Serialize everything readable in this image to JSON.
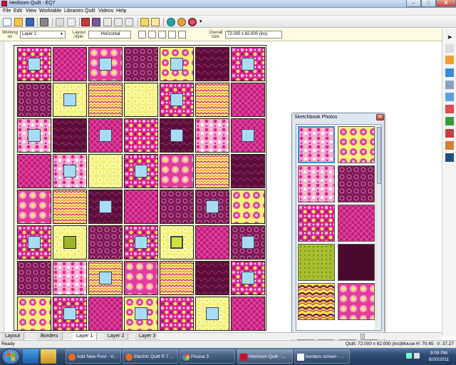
{
  "window": {
    "title": "Heirloom Quilt - EQ7",
    "min_label": "–",
    "max_label": "□",
    "close_label": "X"
  },
  "menu": [
    "File",
    "Edit",
    "View",
    "Worktable",
    "Libraries",
    "Quilt",
    "Videos",
    "Help"
  ],
  "propbar": {
    "working_on_label": "Working on",
    "working_on_value": "Layer 1",
    "layout_style_label": "Layout style:",
    "layout_style_value": "Horizontal",
    "overall_size_label": "Overall size:",
    "overall_size_value": "72.000 x 82.000 (ins)"
  },
  "sketchbook": {
    "title": "Sketchbook Photos",
    "close_label": "x",
    "view_buttons": [
      "□",
      "⊞",
      "▦",
      "⊞"
    ]
  },
  "tabs": [
    {
      "label": "Layout",
      "active": false
    },
    {
      "label": "Borders",
      "active": false
    },
    {
      "label": "Layer 1",
      "active": true
    },
    {
      "label": "Layer 2",
      "active": false
    },
    {
      "label": "Layer 3",
      "active": false
    }
  ],
  "status": {
    "ready": "Ready",
    "quilt_size": "Quilt: 72.000 x 82.000 (ins)",
    "mouse_label": "Mouse",
    "mouse_h": "H: 70.65",
    "mouse_v": "V: 37.27"
  },
  "taskbar": {
    "items": [
      {
        "label": "Add New Post - V...",
        "active": false
      },
      {
        "label": "Electric Quilt ® 7 ...",
        "active": false
      },
      {
        "label": "Picasa 3",
        "active": false
      },
      {
        "label": "Heirloom Quilt - ...",
        "active": true
      },
      {
        "label": "borders screen - ...",
        "active": false
      }
    ],
    "time": "9:09 PM",
    "date": "8/20/2011"
  },
  "colors": {
    "magenta": "#d9258f",
    "pink": "#f07cc4",
    "plum": "#7a1550",
    "dark_plum": "#4a0a2e",
    "yellow": "#f4f27a",
    "lime": "#9db52a",
    "light_blue": "#a8dcf4"
  }
}
